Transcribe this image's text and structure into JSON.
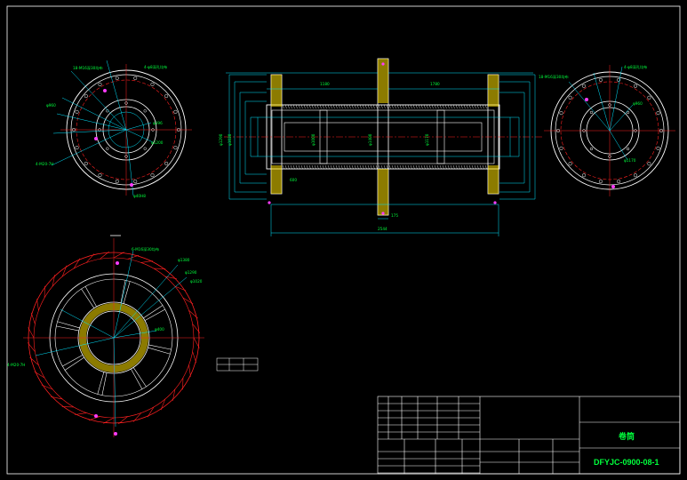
{
  "colors": {
    "background": "#000000",
    "frame": "#ffffff",
    "outline": "#ffffff",
    "centerline": "#ff2020",
    "dimension": "#00e5ff",
    "label": "#00ff3c",
    "hatch": "#ffe000",
    "accent": "#ff3cff"
  },
  "title_block": {
    "drawing_name": "卷筒",
    "drawing_number": "DFYJC-0900-08-1"
  },
  "views": {
    "left_end_view": {
      "labels": [
        "18-M16深30均布",
        "4-φ8深孔均布",
        "φ396",
        "φ1200",
        "φ960",
        "4-M20-7H",
        "φ40H8"
      ]
    },
    "section_view": {
      "labels": [
        "1180",
        "φ1290",
        "φ1020",
        "1780",
        "2544",
        "φ1400",
        "φ1170",
        "φ1000",
        "600",
        "175"
      ]
    },
    "right_end_view": {
      "labels": [
        "18-M16深30均布",
        "4-φ8深孔均布",
        "φ960",
        "φ1170"
      ]
    },
    "bottom_view": {
      "labels": [
        "6-M16深30均布",
        "φ1380",
        "φ1290",
        "φ1020",
        "φ400",
        "4-M20-7H"
      ]
    }
  }
}
